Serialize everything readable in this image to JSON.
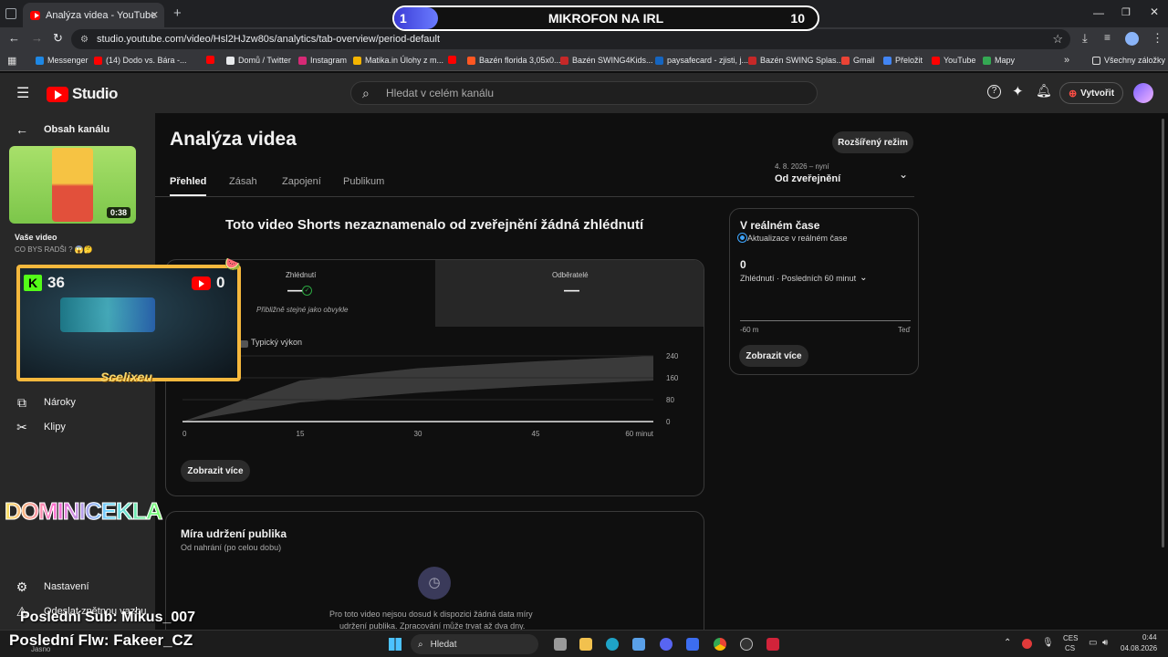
{
  "browser": {
    "tab_title": "Analýza videa - YouTube Studio",
    "new_tab": "+",
    "url": "studio.youtube.com/video/Hsl2HJzw80s/analytics/tab-overview/period-default",
    "bookmarks": [
      {
        "label": "Messenger",
        "color": "#1e88e5"
      },
      {
        "label": "(14) Dodo vs. Bára -...",
        "color": "#ff0000"
      },
      {
        "label": "",
        "color": "#ff0000"
      },
      {
        "label": "Domů / Twitter",
        "color": "#e8eaed"
      },
      {
        "label": "Instagram",
        "color": "#d62976"
      },
      {
        "label": "Matika.in Úlohy z m...",
        "color": "#f4b400"
      },
      {
        "label": "",
        "color": "#ff0000"
      },
      {
        "label": "Bazén florida 3,05x0...",
        "color": "#ff5722"
      },
      {
        "label": "Bazén SWING4Kids...",
        "color": "#c62828"
      },
      {
        "label": "paysafecard - zjisti, j...",
        "color": "#1565c0"
      },
      {
        "label": "Bazén SWING Splas...",
        "color": "#c62828"
      },
      {
        "label": "Gmail",
        "color": "#ea4335"
      },
      {
        "label": "Přeložit",
        "color": "#4285f4"
      },
      {
        "label": "YouTube",
        "color": "#ff0000"
      },
      {
        "label": "Mapy",
        "color": "#34a853"
      }
    ],
    "all_bookmarks": "Všechny záložky"
  },
  "stream_overlay": {
    "counter_left": "1",
    "title": "MIKROFON NA IRL",
    "counter_right": "10",
    "cam_kick_count": "36",
    "cam_yt_count": "0",
    "cam_name": "Scelixeu",
    "brand": "DOMINICEKLA",
    "last_sub": "Poslední Sub: Mikus_007",
    "last_follow": "Poslední Flw: Fakeer_CZ"
  },
  "studio": {
    "logo_text": "Studio",
    "search_placeholder": "Hledat v celém kanálu",
    "create_label": "Vytvořit"
  },
  "sidebar": {
    "back_label": "Obsah kanálu",
    "thumb_duration": "0:38",
    "your_video": "Vaše video",
    "video_title": "CO BYS RADŠI ? 😱🤔",
    "items": [
      {
        "label": "Nároky",
        "icon": "claims-icon"
      },
      {
        "label": "Klipy",
        "icon": "scissors-icon"
      }
    ],
    "settings": "Nastavení",
    "feedback": "Odeslat zpětnou vazbu"
  },
  "page": {
    "title": "Analýza videa",
    "advanced_mode": "Rozšířený režim",
    "tabs": [
      "Přehled",
      "Zásah",
      "Zapojení",
      "Publikum"
    ],
    "period_caption": "4. 8. 2026 – nyní",
    "period_value": "Od zveřejnění",
    "headline": "Toto video Shorts nezaznamenalo od zveřejnění žádná zhlédnutí",
    "metric_views_label": "Zhlédnutí",
    "metric_views_value": "—",
    "metric_views_note": "Přibližně stejné jako obvykle",
    "metric_subs_label": "Odběratelé",
    "metric_subs_value": "—",
    "typical_label": "Typický výkon",
    "see_more": "Zobrazit více",
    "retention_title": "Míra udržení publika",
    "retention_sub": "Od nahrání (po celou dobu)",
    "retention_msg_1": "Pro toto video nejsou dosud k dispozici žádná data míry",
    "retention_msg_2": "udržení publika. Zpracování může trvat až dva dny."
  },
  "realtime": {
    "title": "V reálném čase",
    "live_label": "Aktualizace v reálném čase",
    "count": "0",
    "metric": "Zhlédnutí · Posledních 60 minut",
    "axis_left": "-60 m",
    "axis_right": "Teď",
    "see_more": "Zobrazit více"
  },
  "chart_data": {
    "type": "area",
    "title": "",
    "xlabel": "",
    "ylabel": "",
    "x": [
      0,
      15,
      30,
      45,
      60
    ],
    "x_tick_labels": [
      "0",
      "15",
      "30",
      "45",
      "60 minut"
    ],
    "y_ticks": [
      0,
      80,
      160,
      240
    ],
    "ylim": [
      0,
      240
    ],
    "series": [
      {
        "name": "Typický výkon",
        "band_low": [
          0,
          70,
          105,
          130,
          150
        ],
        "band_high": [
          0,
          150,
          195,
          220,
          240
        ]
      },
      {
        "values": [
          0,
          0,
          0,
          0,
          0
        ]
      }
    ]
  },
  "taskbar": {
    "search": "Hledat",
    "lang_1": "CES",
    "lang_2": "CS",
    "time": "0:44",
    "date": "04.08.2026",
    "weather": "Jasno"
  }
}
